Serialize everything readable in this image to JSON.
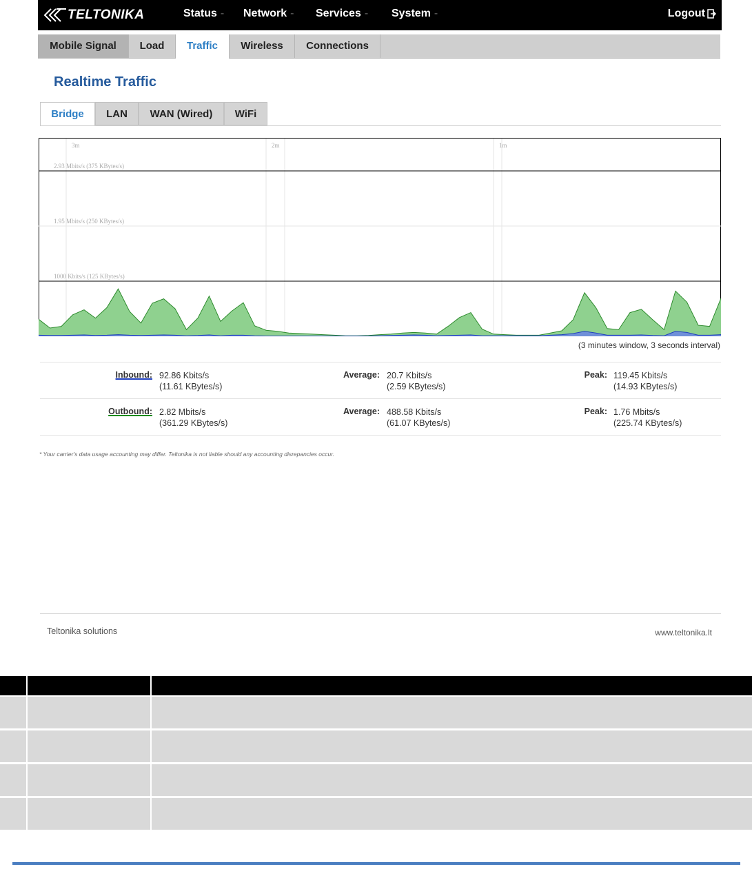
{
  "brand": {
    "name": "TELTONIKA"
  },
  "menu": {
    "items": [
      {
        "label": "Status"
      },
      {
        "label": "Network"
      },
      {
        "label": "Services"
      },
      {
        "label": "System"
      }
    ],
    "logout_label": "Logout"
  },
  "tabs": [
    {
      "label": "Mobile Signal"
    },
    {
      "label": "Load"
    },
    {
      "label": "Traffic",
      "active": true
    },
    {
      "label": "Wireless"
    },
    {
      "label": "Connections"
    }
  ],
  "page_title": "Realtime Traffic",
  "subtabs": [
    {
      "label": "Bridge",
      "active": true
    },
    {
      "label": "LAN"
    },
    {
      "label": "WAN (Wired)"
    },
    {
      "label": "WiFi"
    }
  ],
  "graph": {
    "time_labels": [
      "3m",
      "2m",
      "1m"
    ],
    "scale_labels": [
      "2.93 Mbits/s (375 KBytes/s)",
      "1.95 Mbits/s (250 KBytes/s)",
      "1000 Kbits/s (125 KBytes/s)"
    ],
    "window_note": "(3 minutes window, 3 seconds interval)",
    "colors": {
      "outbound_fill": "#8fd18f",
      "outbound_line": "#2e8b2e",
      "inbound_fill": "#6f8fd8",
      "inbound_line": "#1f3fbf"
    }
  },
  "chart_data": {
    "type": "area",
    "x_unit": "seconds ago",
    "y_unit": "Kbits/s",
    "ylim": [
      0,
      3600
    ],
    "x": [
      180,
      177,
      174,
      171,
      168,
      165,
      162,
      159,
      156,
      153,
      150,
      147,
      144,
      141,
      138,
      135,
      132,
      129,
      126,
      123,
      120,
      117,
      114,
      111,
      108,
      105,
      102,
      99,
      96,
      93,
      90,
      87,
      84,
      81,
      78,
      75,
      72,
      69,
      66,
      63,
      60,
      57,
      54,
      51,
      48,
      45,
      42,
      39,
      36,
      33,
      30,
      27,
      24,
      21,
      18,
      15,
      12,
      9,
      6,
      3,
      0
    ],
    "series": [
      {
        "name": "Outbound",
        "values": [
          310,
          150,
          180,
          390,
          480,
          330,
          520,
          860,
          450,
          240,
          600,
          680,
          500,
          120,
          330,
          730,
          270,
          460,
          610,
          190,
          110,
          90,
          60,
          50,
          40,
          30,
          20,
          10,
          10,
          15,
          30,
          40,
          60,
          70,
          60,
          40,
          180,
          340,
          430,
          130,
          40,
          30,
          20,
          20,
          20,
          60,
          100,
          300,
          790,
          520,
          140,
          120,
          430,
          490,
          300,
          120,
          820,
          620,
          200,
          180,
          690
        ]
      },
      {
        "name": "Inbound",
        "values": [
          20,
          15,
          15,
          20,
          25,
          15,
          20,
          30,
          20,
          15,
          20,
          25,
          20,
          10,
          15,
          25,
          10,
          20,
          20,
          10,
          5,
          5,
          5,
          5,
          5,
          5,
          5,
          5,
          5,
          5,
          10,
          15,
          20,
          25,
          20,
          10,
          15,
          20,
          25,
          10,
          10,
          10,
          10,
          10,
          10,
          20,
          30,
          50,
          90,
          60,
          20,
          20,
          20,
          25,
          15,
          10,
          90,
          70,
          20,
          20,
          30
        ]
      }
    ]
  },
  "stats": {
    "inbound": {
      "label": "Inbound:",
      "current": "92.86 Kbits/s",
      "current_bytes": "(11.61 KBytes/s)",
      "avg_label": "Average:",
      "avg": "20.7 Kbits/s",
      "avg_bytes": "(2.59 KBytes/s)",
      "peak_label": "Peak:",
      "peak": "119.45 Kbits/s",
      "peak_bytes": "(14.93 KBytes/s)"
    },
    "outbound": {
      "label": "Outbound:",
      "current": "2.82 Mbits/s",
      "current_bytes": "(361.29 KBytes/s)",
      "avg_label": "Average:",
      "avg": "488.58 Kbits/s",
      "avg_bytes": "(61.07 KBytes/s)",
      "peak_label": "Peak:",
      "peak": "1.76 Mbits/s",
      "peak_bytes": "(225.74 KBytes/s)"
    }
  },
  "disclaimer": "* Your carrier's data usage accounting may differ. Teltonika is not liable should any accounting disrepancies occur.",
  "footer": {
    "left": "Teltonika solutions",
    "right": "www.teltonika.lt"
  }
}
